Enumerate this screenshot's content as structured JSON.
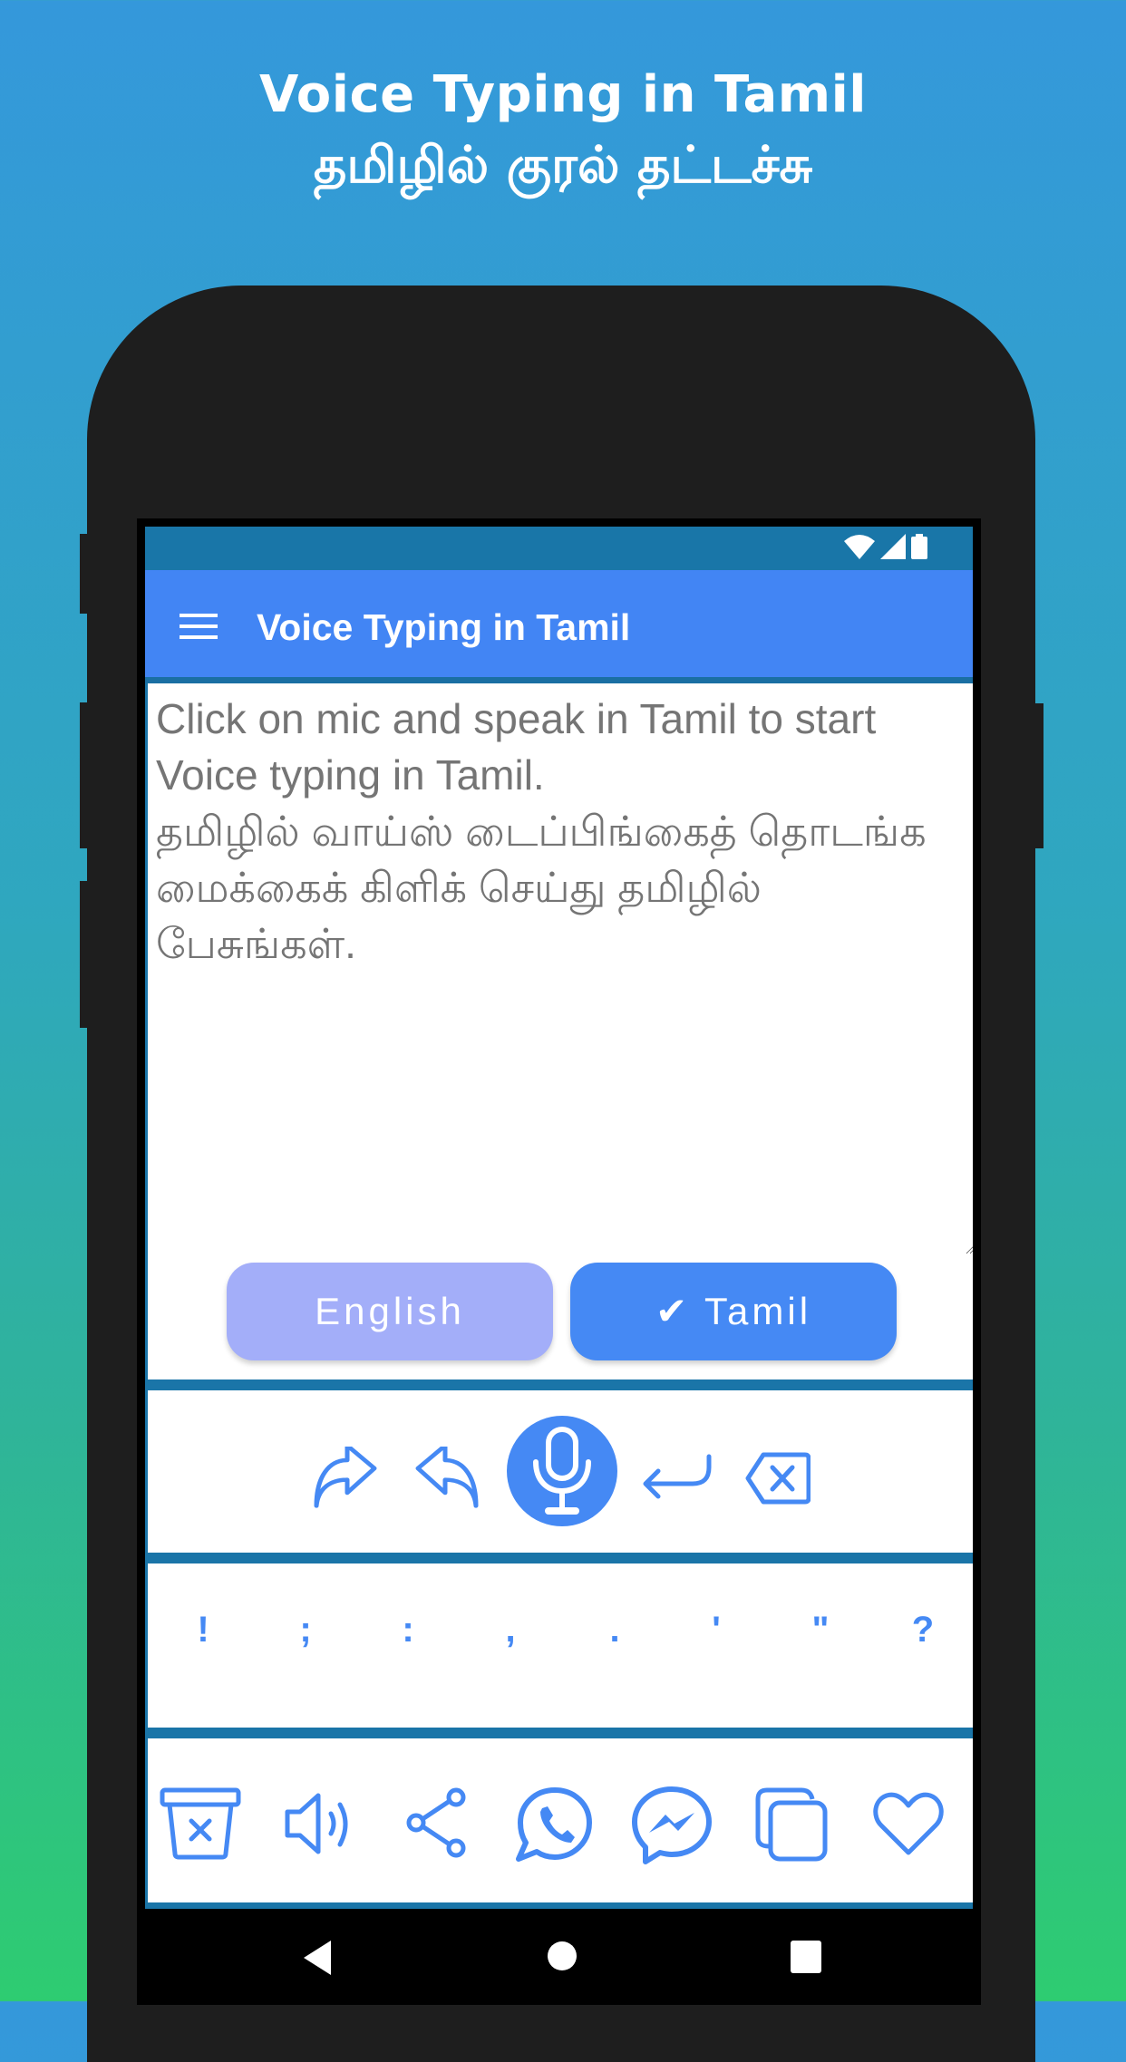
{
  "promo": {
    "title_en": "Voice Typing in Tamil",
    "title_ta": "தமிழில் குரல் தட்டச்சு"
  },
  "status_bar": {
    "icons": [
      "wifi-icon",
      "signal-icon",
      "battery-icon"
    ]
  },
  "app_bar": {
    "menu_icon": "hamburger-menu-icon",
    "title": "Voice Typing in Tamil"
  },
  "editor": {
    "placeholder": "Click on mic and speak in Tamil to start Voice typing in Tamil.\nதமிழில் வாய்ஸ் டைப்பிங்கைத் தொடங்க மைக்கைக் கிளிக் செய்து தமிழில் பேசுங்கள்.",
    "value": ""
  },
  "language_buttons": {
    "english": {
      "label": "English",
      "selected": false
    },
    "tamil": {
      "label": "✔ Tamil",
      "selected": true
    }
  },
  "action_row": [
    {
      "name": "redo",
      "icon": "redo-icon"
    },
    {
      "name": "undo",
      "icon": "undo-icon"
    },
    {
      "name": "mic",
      "icon": "microphone-icon"
    },
    {
      "name": "enter",
      "icon": "enter-icon"
    },
    {
      "name": "backspace",
      "icon": "backspace-icon"
    }
  ],
  "punctuation": [
    "!",
    ";",
    ":",
    ",",
    ".",
    "'",
    "\"",
    "?"
  ],
  "bottom_toolbar": [
    {
      "name": "clear",
      "icon": "trash-clear-icon"
    },
    {
      "name": "speak",
      "icon": "speaker-icon"
    },
    {
      "name": "share",
      "icon": "share-icon"
    },
    {
      "name": "whatsapp",
      "icon": "whatsapp-icon"
    },
    {
      "name": "messenger",
      "icon": "messenger-icon"
    },
    {
      "name": "copy",
      "icon": "copy-icon"
    },
    {
      "name": "favorite",
      "icon": "heart-icon"
    }
  ],
  "nav_bar": [
    "back",
    "home",
    "recents"
  ],
  "colors": {
    "accent": "#4589f4",
    "app_bar": "#4285f4",
    "status_bar": "#1976a8",
    "english_button": "#a3aef9",
    "placeholder_text": "#9e9e9e",
    "bg_top": "#3498db",
    "bg_bottom": "#2ecc71"
  }
}
